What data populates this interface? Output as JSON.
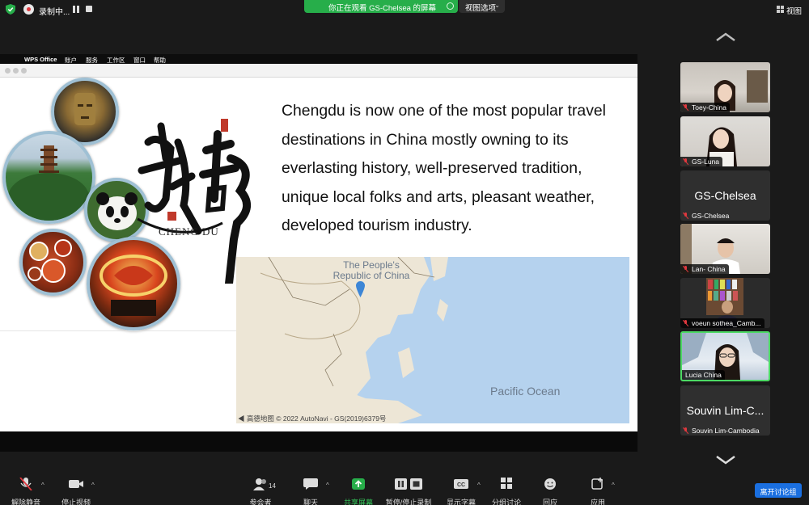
{
  "top_bar": {
    "recording_label": "录制中...",
    "viewing_banner": "你正在观看 GS-Chelsea 的屏幕",
    "view_options": "视图选项",
    "view_label": "视图"
  },
  "shared_screen": {
    "menubar": {
      "app_name": "WPS Office",
      "menus": [
        "账户",
        "服务",
        "工作区",
        "窗口",
        "帮助"
      ]
    },
    "slide": {
      "caption": "CHENG DU",
      "lines": [
        "Chengdu is now one of the most popular travel",
        "destinations in China mostly owning to its",
        "everlasting history, well-preserved tradition,",
        "unique local folks and arts, pleasant weather,",
        "developed tourism industry."
      ],
      "map": {
        "title_line1": "The People's",
        "title_line2": "Republic of China",
        "ocean_label": "Pacific Ocean",
        "credit": "◀ 高德地图  © 2022 AutoNavi - GS(2019)6379号"
      }
    }
  },
  "participants": [
    {
      "name": "Toey-China",
      "muted": true,
      "video": true
    },
    {
      "name": "GS-Luna",
      "muted": true,
      "video": true
    },
    {
      "name": "GS-Chelsea",
      "big_name": "GS-Chelsea",
      "muted": true,
      "video": false
    },
    {
      "name": "Lan- China",
      "muted": true,
      "video": true
    },
    {
      "name": "voeun sothea_Camb...",
      "muted": true,
      "video": true
    },
    {
      "name": "Lucia China",
      "muted": false,
      "video": true,
      "active_speaker": true
    },
    {
      "name": "Souvin Lim-Cambodia",
      "big_name": "Souvin Lim-C...",
      "muted": true,
      "video": false
    }
  ],
  "toolbar": {
    "unmute": "解除静音",
    "stop_video": "停止视频",
    "participants": "参会者",
    "participant_count": "14",
    "chat": "聊天",
    "share_screen": "共享屏幕",
    "pause_stop_recording": "暂停/停止录制",
    "show_captions": "显示字幕",
    "breakout_rooms": "分组讨论",
    "reactions": "回应",
    "apps": "应用",
    "leave_breakout": "离开讨论组"
  },
  "colors": {
    "accent_green": "#27ae4a",
    "leave_blue": "#1a6fe0",
    "active_border": "#4cd964",
    "muted_red": "#e0383e"
  }
}
